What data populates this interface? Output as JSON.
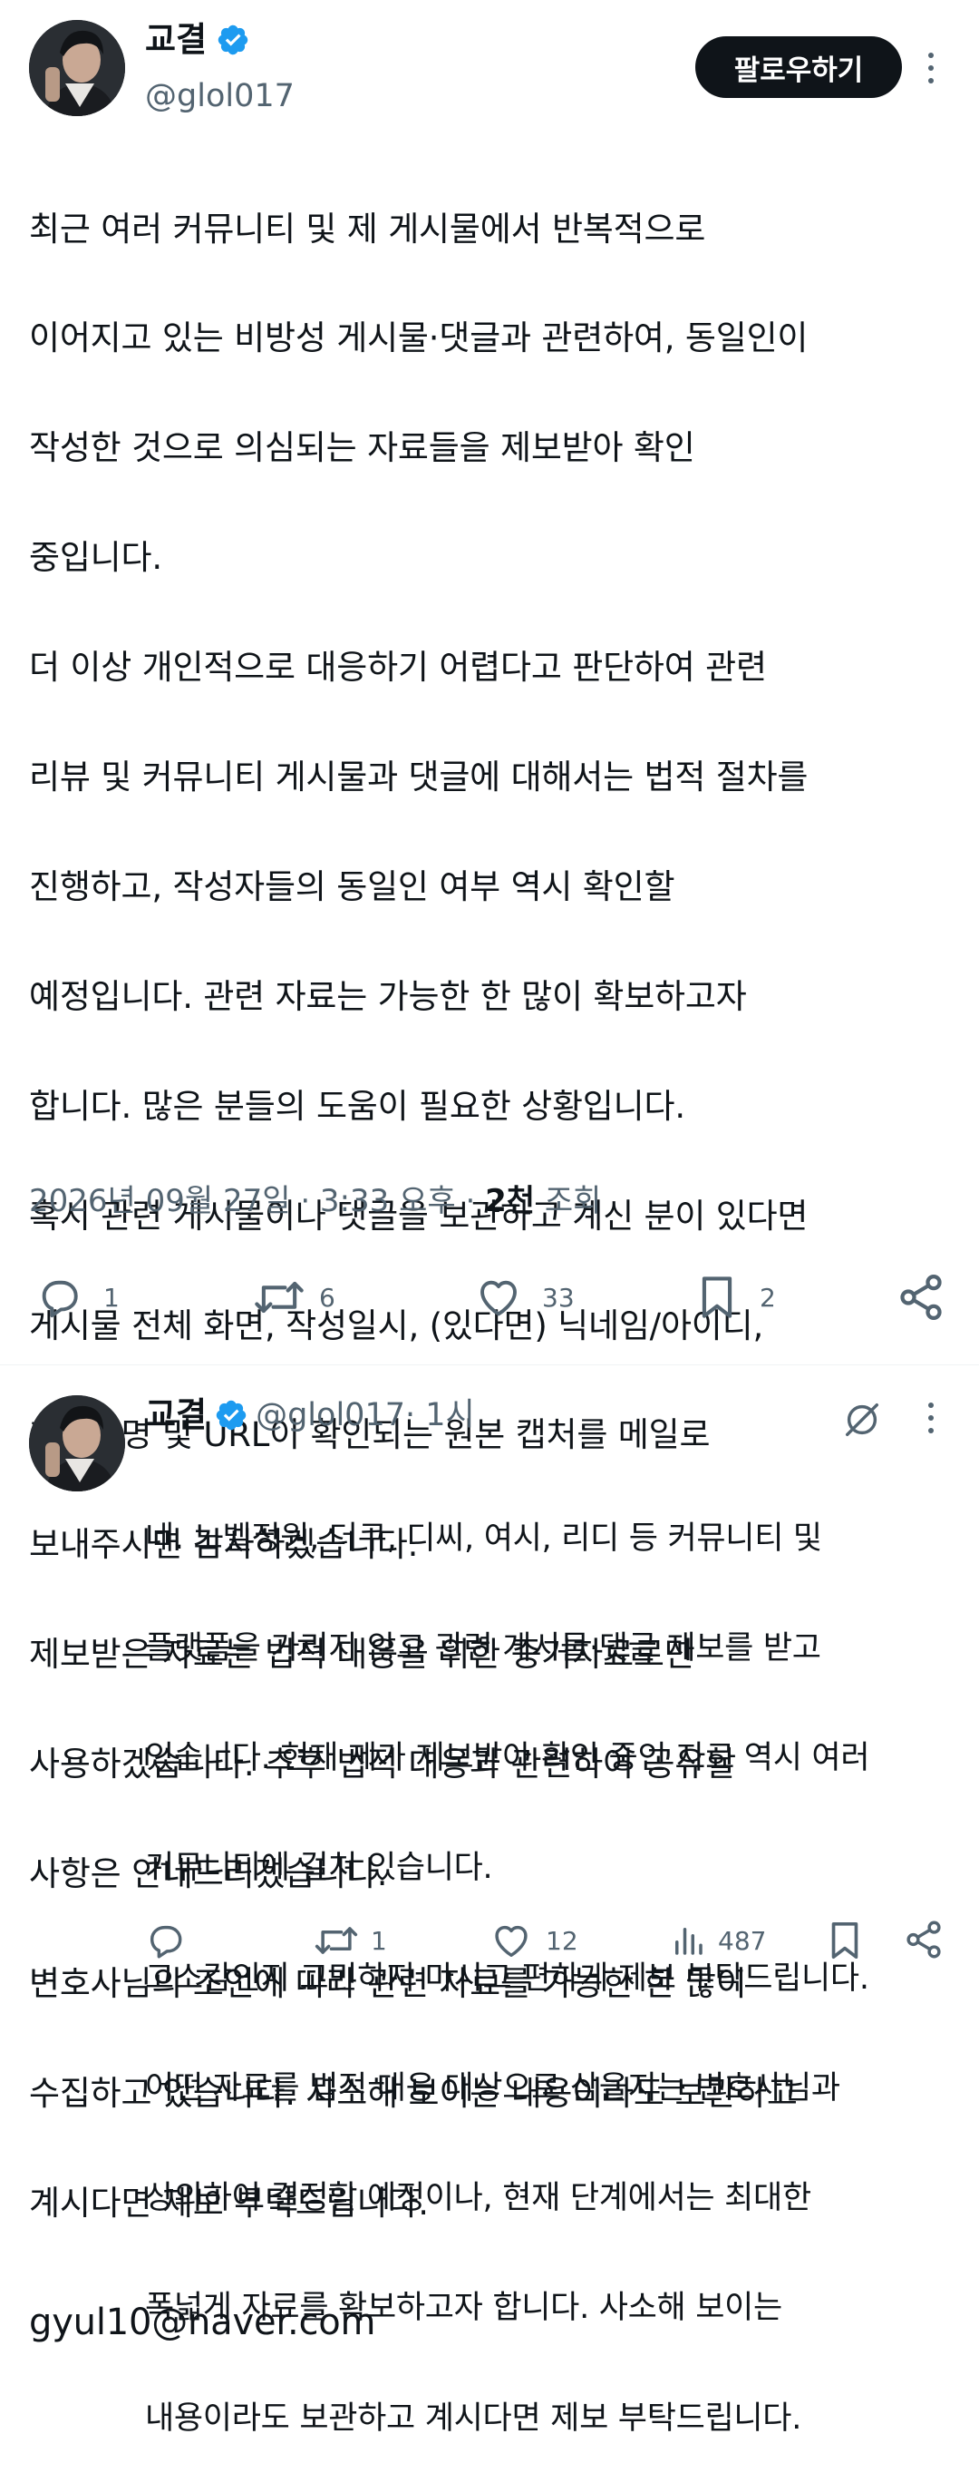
{
  "main_tweet": {
    "author_name": "교결",
    "author_handle": "@glol017",
    "follow_label": "팔로우하기",
    "body_lines": [
      "최근 여러 커뮤니티 및 제 게시물에서 반복적으로",
      "이어지고 있는 비방성 게시물·댓글과 관련하여, 동일인이",
      "작성한 것으로 의심되는 자료들을 제보받아 확인",
      "중입니다.",
      "더 이상 개인적으로 대응하기 어렵다고 판단하여 관련",
      "리뷰 및 커뮤니티 게시물과 댓글에 대해서는 법적 절차를",
      "진행하고, 작성자들의 동일인 여부 역시 확인할",
      "예정입니다. 관련 자료는 가능한 한 많이 확보하고자",
      "합니다. 많은 분들의 도움이 필요한 상황입니다.",
      "혹시 관련 게시물이나 댓글을 보관하고 계신 분이 있다면",
      "게시물 전체 화면, 작성일시, (있다면) 닉네임/아이디,",
      "게시판명 및 URL이 확인되는 원본 캡처를 메일로",
      "보내주시면 감사하겠습니다.",
      "제보받은 자료는 법적 대응을 위한 증거자료로만",
      "사용하겠습니다. 추후 법적 대응과 관련하여 공유할",
      "사항은 안내드리겠습니다.",
      "변호사님의 조언에 따라 관련 자료를 가능한 한 많이",
      "수집하고 있습니다. 사소해 보이는 내용이라도 보관하고",
      "계시다면 제보 부탁드립니다.",
      "gyul10@naver.com"
    ],
    "timestamp": "2026년 09월 27일 · 3:33 오후 · ",
    "views_count": "2천",
    "views_label": " 조회",
    "actions": {
      "reply_count": "1",
      "retweet_count": "6",
      "like_count": "33",
      "bookmark_count": "2"
    }
  },
  "reply_tweet": {
    "author_name": "교결",
    "author_handle": "@glol017",
    "time": " · 1시",
    "body_lines": [
      "네. 노벨정원, 더쿠, 디씨, 여시, 리디 등 커뮤니티 및",
      "플랫폼을 가리지 않고 관련 게시물·댓글 제보를 받고",
      "있습니다. 현재 제가 제보받아 확인 중인 자료 역시 여러",
      "커뮤니티에 걸쳐 있습니다.",
      "고소감인지 고민하지 마시고 편하게 제보 부탁드립니다.",
      "어떤 자료를 법적 대응 대상으로 삼을지는 변호사님과",
      "상의하여 결정할 예정이나, 현재 단계에서는 최대한",
      "폭넓게 자료를 확보하고자 합니다. 사소해 보이는",
      "내용이라도 보관하고 계시다면 제보 부탁드립니다."
    ],
    "actions": {
      "retweet_count": "1",
      "like_count": "12",
      "views_count": "487"
    }
  },
  "colors": {
    "text": "#0f1419",
    "secondary": "#536471",
    "verified": "#1d9bf0",
    "divider": "#eff3f4"
  }
}
